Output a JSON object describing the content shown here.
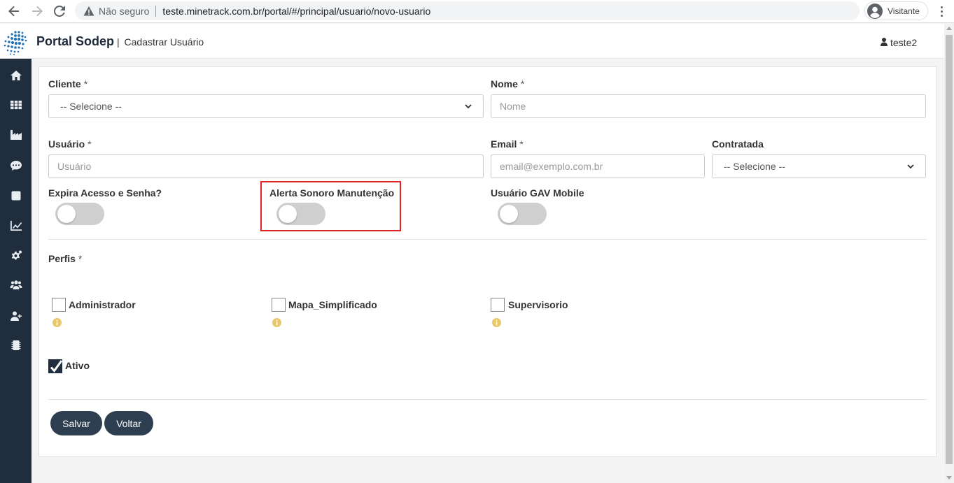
{
  "browser": {
    "not_secure": "Não seguro",
    "url": "teste.minetrack.com.br/portal/#/principal/usuario/novo-usuario",
    "profile_name": "Visitante"
  },
  "header": {
    "brand": "Portal Sodep",
    "separator": "|",
    "page_title": "Cadastrar Usuário",
    "user": "teste2"
  },
  "sidebar": {
    "items": [
      {
        "icon": "home-icon"
      },
      {
        "icon": "grid-icon"
      },
      {
        "icon": "factory-icon"
      },
      {
        "icon": "chat-icon"
      },
      {
        "icon": "square-icon"
      },
      {
        "icon": "line-chart-icon"
      },
      {
        "icon": "gears-icon"
      },
      {
        "icon": "users-icon"
      },
      {
        "icon": "user-plus-icon"
      },
      {
        "icon": "chip-icon"
      }
    ]
  },
  "form": {
    "cliente": {
      "label": "Cliente",
      "required": "*",
      "value": "-- Selecione --"
    },
    "nome": {
      "label": "Nome",
      "required": "*",
      "placeholder": "Nome"
    },
    "usuario": {
      "label": "Usuário",
      "required": "*",
      "placeholder": "Usuário"
    },
    "email": {
      "label": "Email",
      "required": "*",
      "placeholder": "email@exemplo.com.br"
    },
    "contratada": {
      "label": "Contratada",
      "value": "-- Selecione --"
    },
    "toggles": {
      "expira": {
        "label": "Expira Acesso e Senha?",
        "on": false
      },
      "alerta": {
        "label": "Alerta Sonoro Manutenção",
        "on": false
      },
      "gav": {
        "label": "Usuário GAV Mobile",
        "on": false
      }
    },
    "perfis": {
      "label": "Perfis",
      "required": "*",
      "options": [
        {
          "label": "Administrador",
          "checked": false
        },
        {
          "label": "Mapa_Simplificado",
          "checked": false
        },
        {
          "label": "Supervisorio",
          "checked": false
        }
      ]
    },
    "ativo": {
      "label": "Ativo",
      "checked": true
    },
    "buttons": {
      "save": "Salvar",
      "back": "Voltar"
    }
  },
  "colors": {
    "sidebar": "#1f2d3d",
    "button": "#2c3e50",
    "highlight": "#e02424",
    "info_icon": "#e8c66a"
  }
}
